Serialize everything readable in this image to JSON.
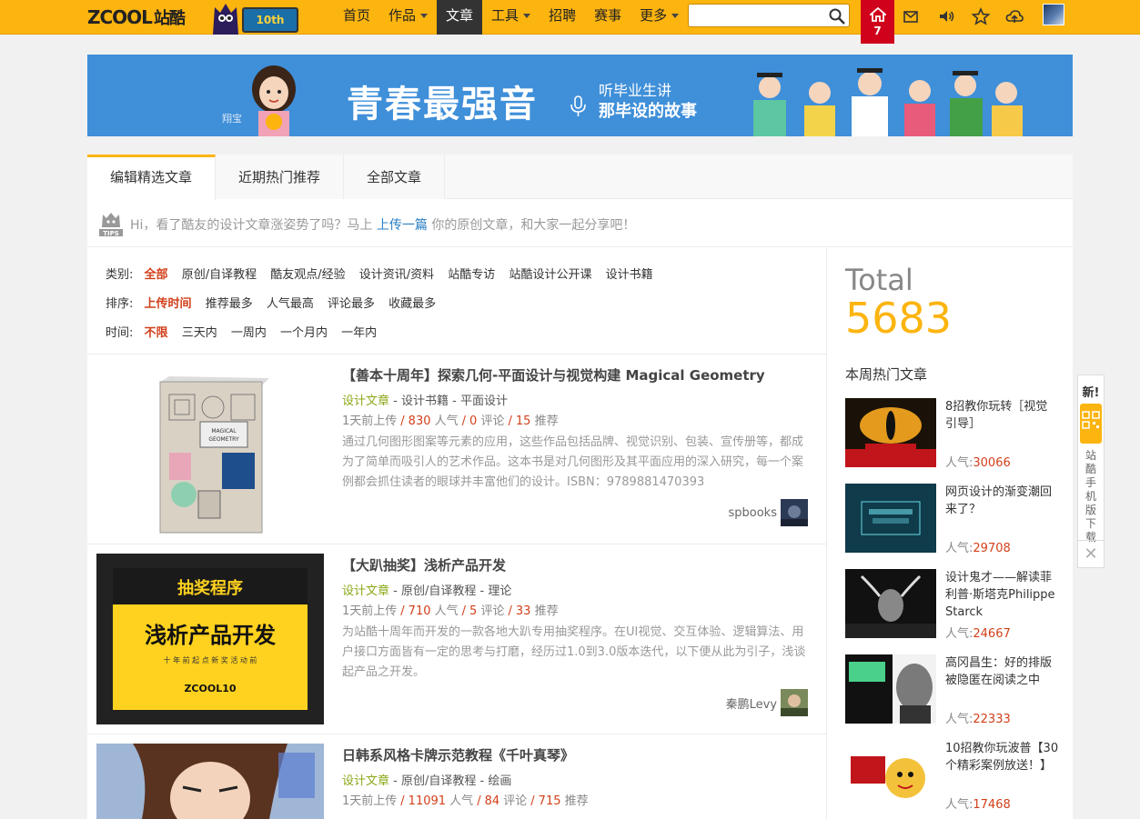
{
  "header": {
    "logo_text": "ZCOOL",
    "logo_cn": "站酷",
    "badge": "10th",
    "nav": [
      {
        "label": "首页",
        "caret": false,
        "active": false
      },
      {
        "label": "作品",
        "caret": true,
        "active": false
      },
      {
        "label": "文章",
        "caret": false,
        "active": true
      },
      {
        "label": "工具",
        "caret": true,
        "active": false
      },
      {
        "label": "招聘",
        "caret": false,
        "active": false
      },
      {
        "label": "赛事",
        "caret": false,
        "active": false
      },
      {
        "label": "更多",
        "caret": true,
        "active": false
      }
    ],
    "search_value": "",
    "home_count": "7"
  },
  "banner": {
    "title": "青春最强音",
    "sub1": "听毕业生讲",
    "sub2": "那毕设的故事",
    "small": "翔宝"
  },
  "tabs": [
    "编辑精选文章",
    "近期热门推荐",
    "全部文章"
  ],
  "tips": {
    "before": "Hi，看了酷友的设计文章涨姿势了吗？马上",
    "link": "上传一篇",
    "after": "你的原创文章，和大家一起分享吧！"
  },
  "filters": {
    "category": {
      "label": "类别:",
      "options": [
        "全部",
        "原创/自译教程",
        "酷友观点/经验",
        "设计资讯/资料",
        "站酷专访",
        "站酷设计公开课",
        "设计书籍"
      ],
      "selected": 0
    },
    "sort": {
      "label": "排序:",
      "options": [
        "上传时间",
        "推荐最多",
        "人气最高",
        "评论最多",
        "收藏最多"
      ],
      "selected": 0
    },
    "time": {
      "label": "时间:",
      "options": [
        "不限",
        "三天内",
        "一周内",
        "一个月内",
        "一年内"
      ],
      "selected": 0
    }
  },
  "articles": [
    {
      "title": "【善本十周年】探索几何-平面设计与视觉构建 Magical Geometry",
      "cat_main": "设计文章",
      "cat_sub1": "设计书籍",
      "cat_sub2": "平面设计",
      "uploaded": "1天前上传",
      "popularity": "830",
      "comments": "0",
      "recommends": "15",
      "desc": "通过几何图形图案等元素的应用，这些作品包括品牌、视觉识别、包装、宣传册等，都成为了简单而吸引人的艺术作品。这本书是对几何图形及其平面应用的深入研究，每一个案例都会抓住读者的眼球并丰富他们的设计。ISBN：9789881470393",
      "author": "spbooks"
    },
    {
      "title": "【大趴抽奖】浅析产品开发",
      "cat_main": "设计文章",
      "cat_sub1": "原创/自译教程",
      "cat_sub2": "理论",
      "uploaded": "1天前上传",
      "popularity": "710",
      "comments": "5",
      "recommends": "33",
      "desc": "为站酷十周年而开发的一款各地大趴专用抽奖程序。在UI视觉、交互体验、逻辑算法、用户接口方面皆有一定的思考与打磨，经历过1.0到3.0版本迭代，以下便从此为引子，浅谈起产品之开发。",
      "author": "秦鹏Levy",
      "thumb_line1": "抽奖程序",
      "thumb_line2": "浅析产品开发",
      "thumb_line3": "十 年 前 起 点   新 奖 活 动 前",
      "thumb_brand": "ZCOOL10"
    },
    {
      "title": "日韩系风格卡牌示范教程《千叶真琴》",
      "cat_main": "设计文章",
      "cat_sub1": "原创/自译教程",
      "cat_sub2": "绘画",
      "uploaded": "1天前上传",
      "popularity": "11091",
      "comments": "84",
      "recommends": "715"
    }
  ],
  "stats_labels": {
    "popularity": "人气",
    "comments": "评论",
    "recommends": "推荐"
  },
  "total": {
    "label": "Total",
    "value": "5683"
  },
  "hot": {
    "title": "本周热门文章",
    "pop_label": "人气:",
    "items": [
      {
        "title": "8招教你玩转［视觉引导］",
        "pop": "30066"
      },
      {
        "title": "网页设计的渐变潮回来了？",
        "pop": "29708"
      },
      {
        "title": "设计鬼才——解读菲利普·斯塔克Philippe Starck",
        "pop": "24667"
      },
      {
        "title": "高冈昌生：好的排版被隐匿在阅读之中",
        "pop": "22333"
      },
      {
        "title": "10招教你玩波普【30个精彩案例放送！】",
        "pop": "17468"
      }
    ]
  },
  "qr": {
    "new": "新!",
    "text": "站酷手机版下载"
  },
  "colors": {
    "brand": "#fcb40f",
    "accent_red": "#d23f1a",
    "green": "#8aa817",
    "home_red": "#d0021b"
  }
}
